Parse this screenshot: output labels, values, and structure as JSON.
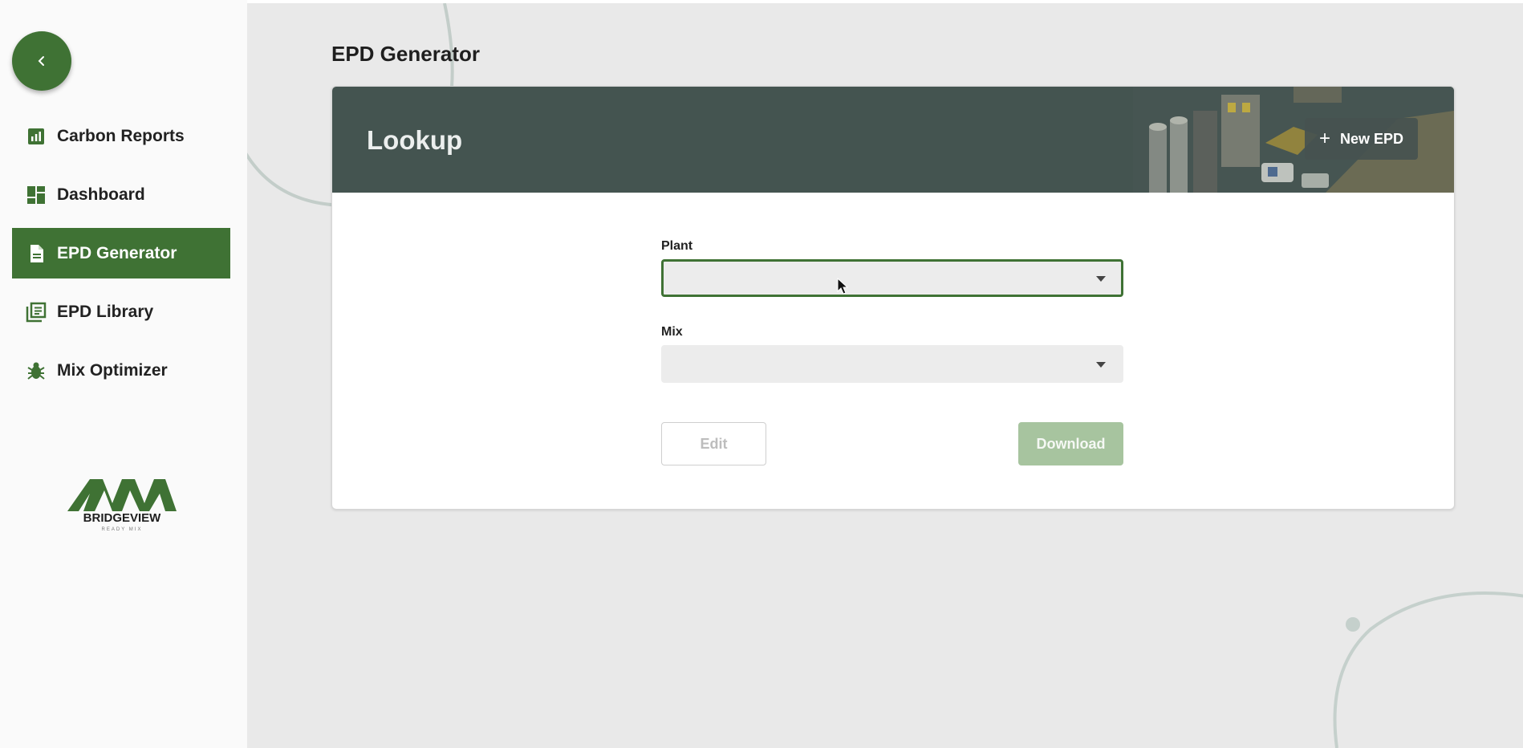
{
  "sidebar": {
    "collapse_icon": "chevron-left-icon",
    "items": [
      {
        "label": "Carbon Reports",
        "icon": "bar-chart-icon",
        "active": false
      },
      {
        "label": "Dashboard",
        "icon": "dashboard-icon",
        "active": false
      },
      {
        "label": "EPD Generator",
        "icon": "document-icon",
        "active": true
      },
      {
        "label": "EPD Library",
        "icon": "library-icon",
        "active": false
      },
      {
        "label": "Mix Optimizer",
        "icon": "bug-icon",
        "active": false
      }
    ],
    "logo": {
      "name": "BRIDGEVIEW",
      "tagline": "READY MIX"
    }
  },
  "main": {
    "page_title": "EPD Generator",
    "card": {
      "title": "Lookup",
      "new_button": {
        "label": "New EPD",
        "icon": "plus-icon"
      },
      "plant": {
        "label": "Plant",
        "value": ""
      },
      "mix": {
        "label": "Mix",
        "value": ""
      },
      "edit_label": "Edit",
      "download_label": "Download"
    }
  },
  "colors": {
    "brand_green": "#3f7234",
    "header_bg": "#445450",
    "disabled_green": "#a7c49f",
    "main_bg": "#e9e9e9"
  }
}
